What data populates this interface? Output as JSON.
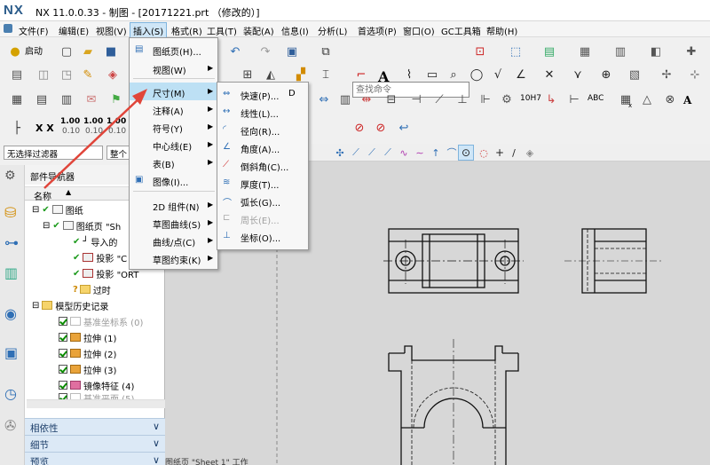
{
  "window": {
    "logo": "NX",
    "title": "NX 11.0.0.33 - 制图 - [20171221.prt （修改的）]"
  },
  "menubar": {
    "items": [
      {
        "label": "文件(F)"
      },
      {
        "label": "编辑(E)"
      },
      {
        "label": "视图(V)"
      },
      {
        "label": "插入(S)"
      },
      {
        "label": "格式(R)"
      },
      {
        "label": "工具(T)"
      },
      {
        "label": "装配(A)"
      },
      {
        "label": "信息(I)"
      },
      {
        "label": "分析(L)"
      },
      {
        "label": "首选项(P)"
      },
      {
        "label": "窗口(O)"
      },
      {
        "label": "GC工具箱"
      },
      {
        "label": "帮助(H)"
      }
    ]
  },
  "toolbar": {
    "start_label": "启动",
    "find_command_placeholder": "查找命令",
    "xx_label": "X X",
    "decimal_labels": [
      "1.00",
      "1.00",
      "1.00"
    ],
    "decimal_sub_labels": [
      "0.10",
      "0.10",
      "0.10"
    ],
    "tolerance_label": "10H7",
    "abc_label": "ABC",
    "text_a_label": "A",
    "sub_x_label": "x"
  },
  "filter": {
    "selection_filter": "无选择过滤器",
    "scope": "整个"
  },
  "navigator": {
    "title": "部件导航器",
    "column_name": "名称",
    "tree": [
      {
        "label": "图纸"
      },
      {
        "label": "图纸页 \"Sh"
      },
      {
        "label": "导入的"
      },
      {
        "label": "投影 \"C"
      },
      {
        "label": "投影 \"ORT"
      },
      {
        "label": "过时"
      },
      {
        "label": "模型历史记录"
      },
      {
        "label": "基准坐标系 (0)"
      },
      {
        "label": "拉伸 (1)"
      },
      {
        "label": "拉伸 (2)"
      },
      {
        "label": "拉伸 (3)"
      },
      {
        "label": "镜像特征 (4)"
      },
      {
        "label": "基准平面 (5)"
      }
    ],
    "sections": [
      "相依性",
      "细节",
      "预览"
    ]
  },
  "insert_menu": {
    "items": [
      {
        "label": "图纸页(H)...",
        "submenu": false
      },
      {
        "label": "视图(W)",
        "submenu": true
      },
      {
        "label": "尺寸(M)",
        "submenu": true
      },
      {
        "label": "注释(A)",
        "submenu": true
      },
      {
        "label": "符号(Y)",
        "submenu": true
      },
      {
        "label": "中心线(E)",
        "submenu": true
      },
      {
        "label": "表(B)",
        "submenu": true
      },
      {
        "label": "图像(I)...",
        "submenu": false
      },
      {
        "label": "2D 组件(N)",
        "submenu": true
      },
      {
        "label": "草图曲线(S)",
        "submenu": true
      },
      {
        "label": "曲线/点(C)",
        "submenu": true
      },
      {
        "label": "草图约束(K)",
        "submenu": true
      }
    ]
  },
  "dimension_submenu": {
    "items": [
      {
        "label": "快速(P)...",
        "shortcut": "D",
        "enabled": true
      },
      {
        "label": "线性(L)...",
        "enabled": true
      },
      {
        "label": "径向(R)...",
        "enabled": true
      },
      {
        "label": "角度(A)...",
        "enabled": true
      },
      {
        "label": "倒斜角(C)...",
        "enabled": true
      },
      {
        "label": "厚度(T)...",
        "enabled": true
      },
      {
        "label": "弧长(G)...",
        "enabled": true
      },
      {
        "label": "周长(E)...",
        "enabled": false
      },
      {
        "label": "坐标(O)...",
        "enabled": true
      }
    ]
  },
  "status": {
    "text": "图纸页 \"Sheet 1\" 工作"
  },
  "colors": {
    "accent": "#cfe6f7",
    "highlight": "#bde0f4",
    "arrow": "#e0453a",
    "panel": "#dce9f6"
  }
}
